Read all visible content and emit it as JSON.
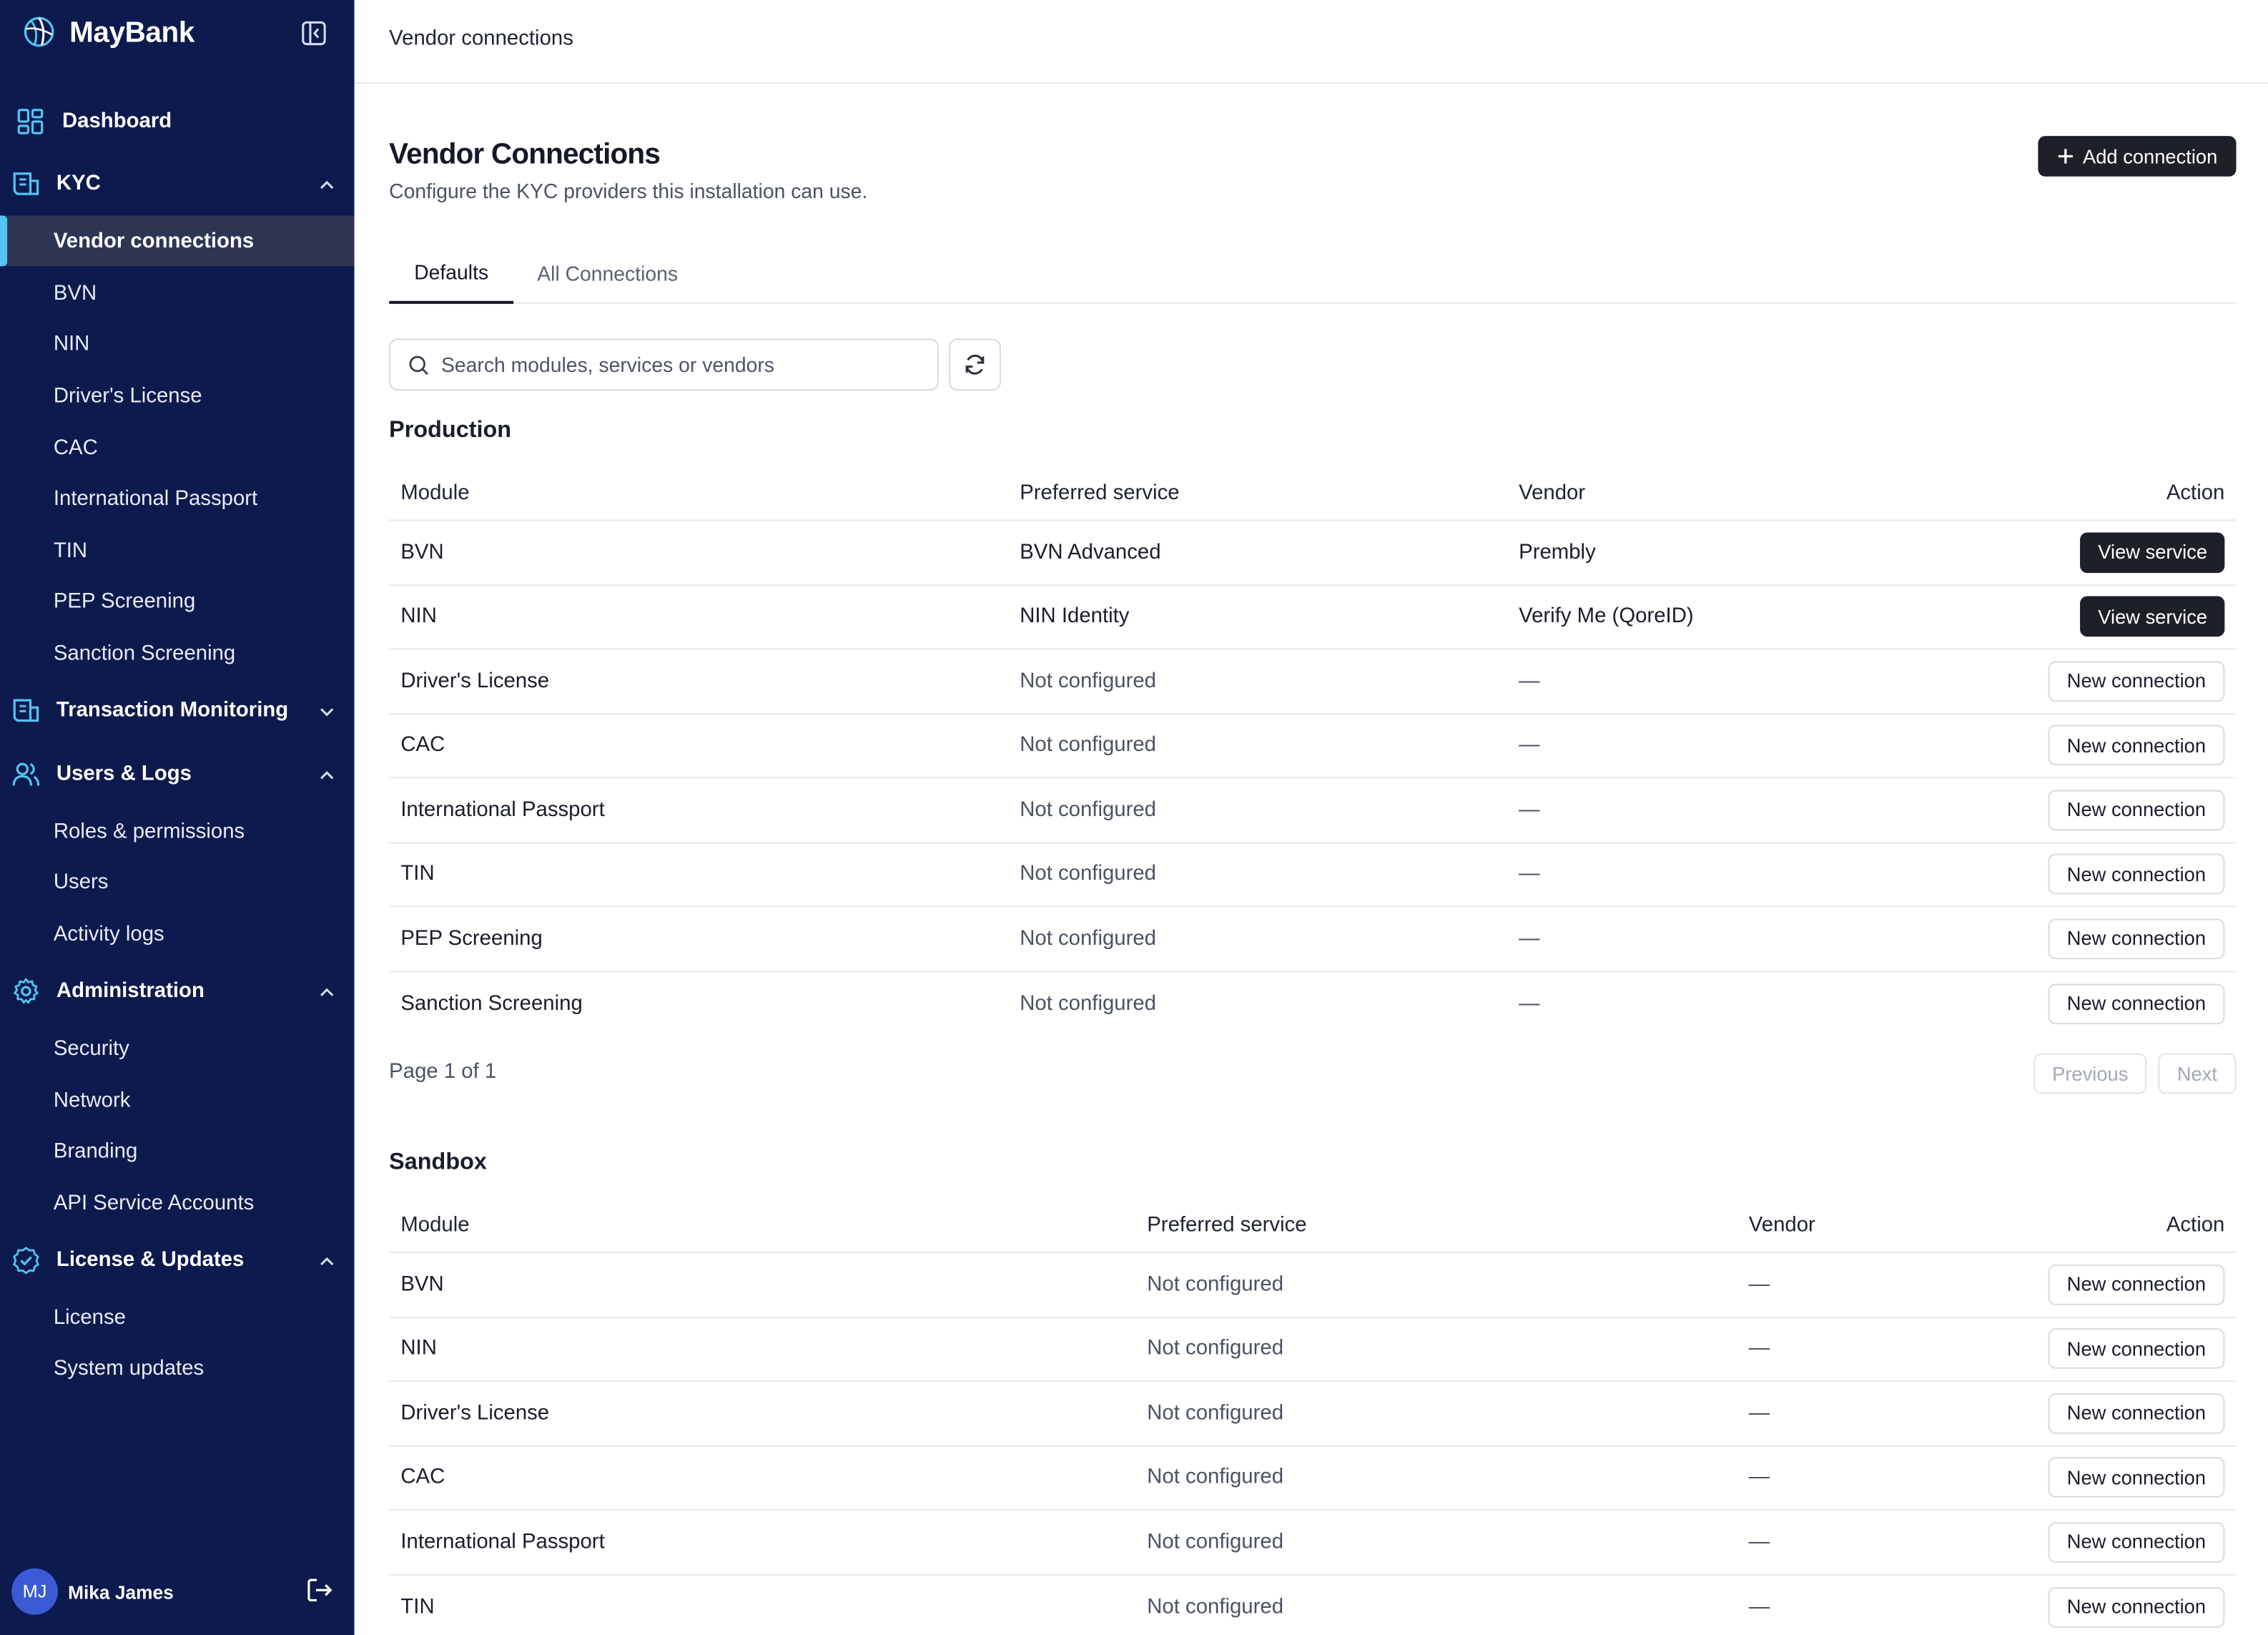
{
  "app": {
    "name": "MayBank"
  },
  "sidebar": {
    "sections": [
      {
        "label": "Dashboard",
        "icon": "dashboard-icon"
      },
      {
        "label": "KYC",
        "icon": "kyc-icon",
        "expanded": true,
        "items": [
          "Vendor connections",
          "BVN",
          "NIN",
          "Driver's License",
          "CAC",
          "International Passport",
          "TIN",
          "PEP Screening",
          "Sanction Screening"
        ]
      },
      {
        "label": "Transaction Monitoring",
        "icon": "transaction-monitoring-icon",
        "expanded": false
      },
      {
        "label": "Users & Logs",
        "icon": "users-icon",
        "expanded": true,
        "items": [
          "Roles & permissions",
          "Users",
          "Activity logs"
        ]
      },
      {
        "label": "Administration",
        "icon": "gear-icon",
        "expanded": true,
        "items": [
          "Security",
          "Network",
          "Branding",
          "API Service Accounts"
        ]
      },
      {
        "label": "License & Updates",
        "icon": "check-badge-icon",
        "expanded": true,
        "items": [
          "License",
          "System updates"
        ]
      }
    ],
    "active_item": "Vendor connections",
    "user": {
      "initials": "MJ",
      "name": "Mika James"
    }
  },
  "header": {
    "breadcrumb": "Vendor connections"
  },
  "page": {
    "title": "Vendor Connections",
    "subtitle": "Configure the KYC providers this installation can use.",
    "add_button": "Add connection",
    "tabs": [
      {
        "label": "Defaults",
        "active": true
      },
      {
        "label": "All Connections",
        "active": false
      }
    ],
    "search": {
      "placeholder": "Search modules, services or vendors",
      "value": ""
    }
  },
  "production": {
    "title": "Production",
    "columns": [
      "Module",
      "Preferred service",
      "Vendor",
      "Action"
    ],
    "rows": [
      {
        "module": "BVN",
        "service": "BVN Advanced",
        "vendor": "Prembly",
        "action": "View service",
        "configured": true
      },
      {
        "module": "NIN",
        "service": "NIN Identity",
        "vendor": "Verify Me (QoreID)",
        "action": "View service",
        "configured": true
      },
      {
        "module": "Driver's License",
        "service": "Not configured",
        "vendor": "—",
        "action": "New connection",
        "configured": false
      },
      {
        "module": "CAC",
        "service": "Not configured",
        "vendor": "—",
        "action": "New connection",
        "configured": false
      },
      {
        "module": "International Passport",
        "service": "Not configured",
        "vendor": "—",
        "action": "New connection",
        "configured": false
      },
      {
        "module": "TIN",
        "service": "Not configured",
        "vendor": "—",
        "action": "New connection",
        "configured": false
      },
      {
        "module": "PEP Screening",
        "service": "Not configured",
        "vendor": "—",
        "action": "New connection",
        "configured": false
      },
      {
        "module": "Sanction Screening",
        "service": "Not configured",
        "vendor": "—",
        "action": "New connection",
        "configured": false
      }
    ],
    "pagination": {
      "info": "Page 1 of 1",
      "previous": "Previous",
      "next": "Next"
    }
  },
  "sandbox": {
    "title": "Sandbox",
    "columns": [
      "Module",
      "Preferred service",
      "Vendor",
      "Action"
    ],
    "rows": [
      {
        "module": "BVN",
        "service": "Not configured",
        "vendor": "—",
        "action": "New connection",
        "configured": false
      },
      {
        "module": "NIN",
        "service": "Not configured",
        "vendor": "—",
        "action": "New connection",
        "configured": false
      },
      {
        "module": "Driver's License",
        "service": "Not configured",
        "vendor": "—",
        "action": "New connection",
        "configured": false
      },
      {
        "module": "CAC",
        "service": "Not configured",
        "vendor": "—",
        "action": "New connection",
        "configured": false
      },
      {
        "module": "International Passport",
        "service": "Not configured",
        "vendor": "—",
        "action": "New connection",
        "configured": false
      },
      {
        "module": "TIN",
        "service": "Not configured",
        "vendor": "—",
        "action": "New connection",
        "configured": false
      }
    ]
  },
  "colors": {
    "sidebar_bg": "#0d1a4d",
    "accent": "#52c3f2",
    "primary_button": "#1e2028"
  }
}
